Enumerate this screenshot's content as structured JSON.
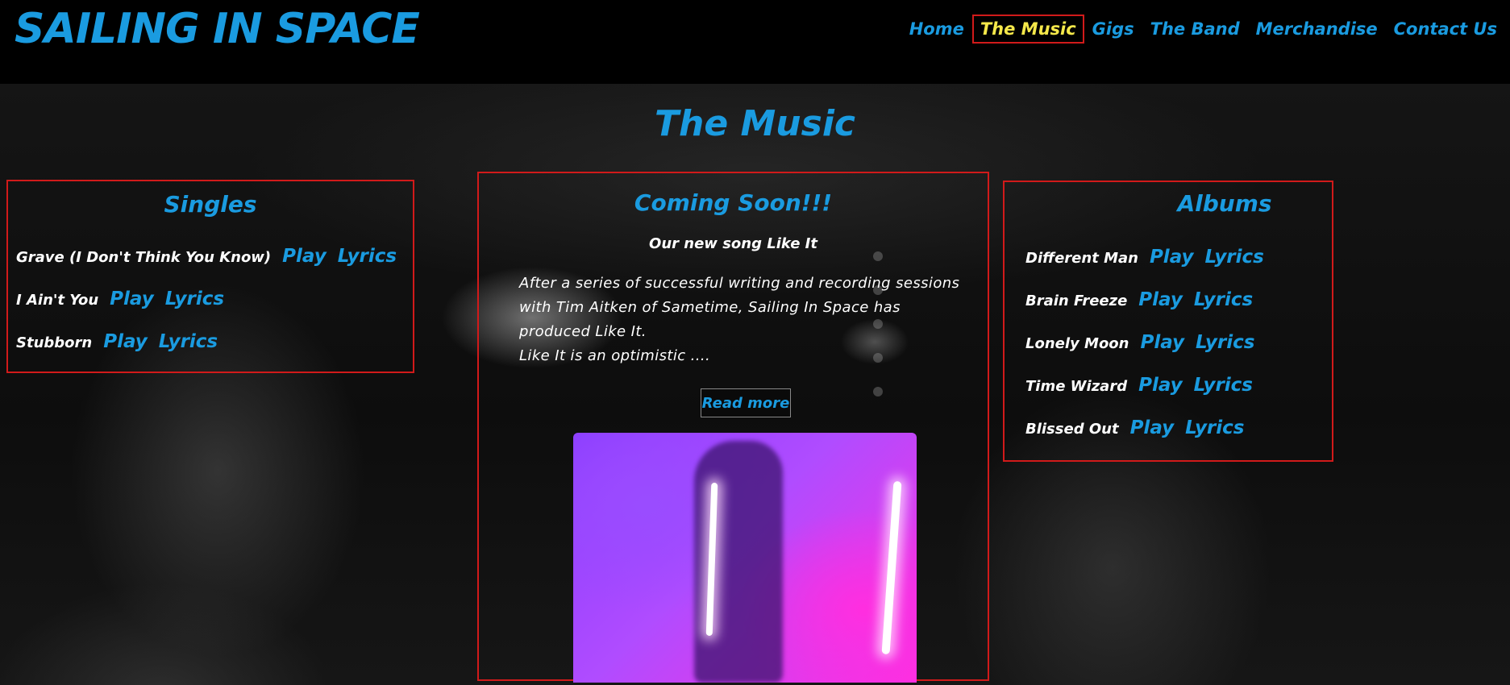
{
  "site": {
    "logo": "SAILING IN SPACE"
  },
  "nav": {
    "items": [
      {
        "label": "Home"
      },
      {
        "label": "The Music"
      },
      {
        "label": "Gigs"
      },
      {
        "label": "The Band"
      },
      {
        "label": "Merchandise"
      },
      {
        "label": "Contact Us"
      }
    ],
    "active": "The Music"
  },
  "page": {
    "title": "The Music"
  },
  "singles": {
    "heading": "Singles",
    "play_label": "Play",
    "lyrics_label": "Lyrics",
    "songs": [
      {
        "title": "Grave (I Don't Think You Know)"
      },
      {
        "title": "I Ain't You"
      },
      {
        "title": "Stubborn"
      }
    ]
  },
  "coming_soon": {
    "heading": "Coming Soon!!!",
    "subheading": "Our new song Like It",
    "body_lines": [
      "After a series of successful writing and recording sessions",
      "with Tim Aitken of Sametime, Sailing In Space has",
      "produced Like It.",
      "Like It is an optimistic ...."
    ],
    "read_more": "Read more"
  },
  "albums": {
    "heading": "Albums",
    "play_label": "Play",
    "lyrics_label": "Lyrics",
    "songs": [
      {
        "title": "Different Man"
      },
      {
        "title": "Brain Freeze"
      },
      {
        "title": "Lonely Moon"
      },
      {
        "title": "Time Wizard"
      },
      {
        "title": "Blissed Out"
      }
    ]
  },
  "colors": {
    "accent": "#1a9be0",
    "active_nav": "#f5e84a",
    "border": "#d11a1a"
  }
}
